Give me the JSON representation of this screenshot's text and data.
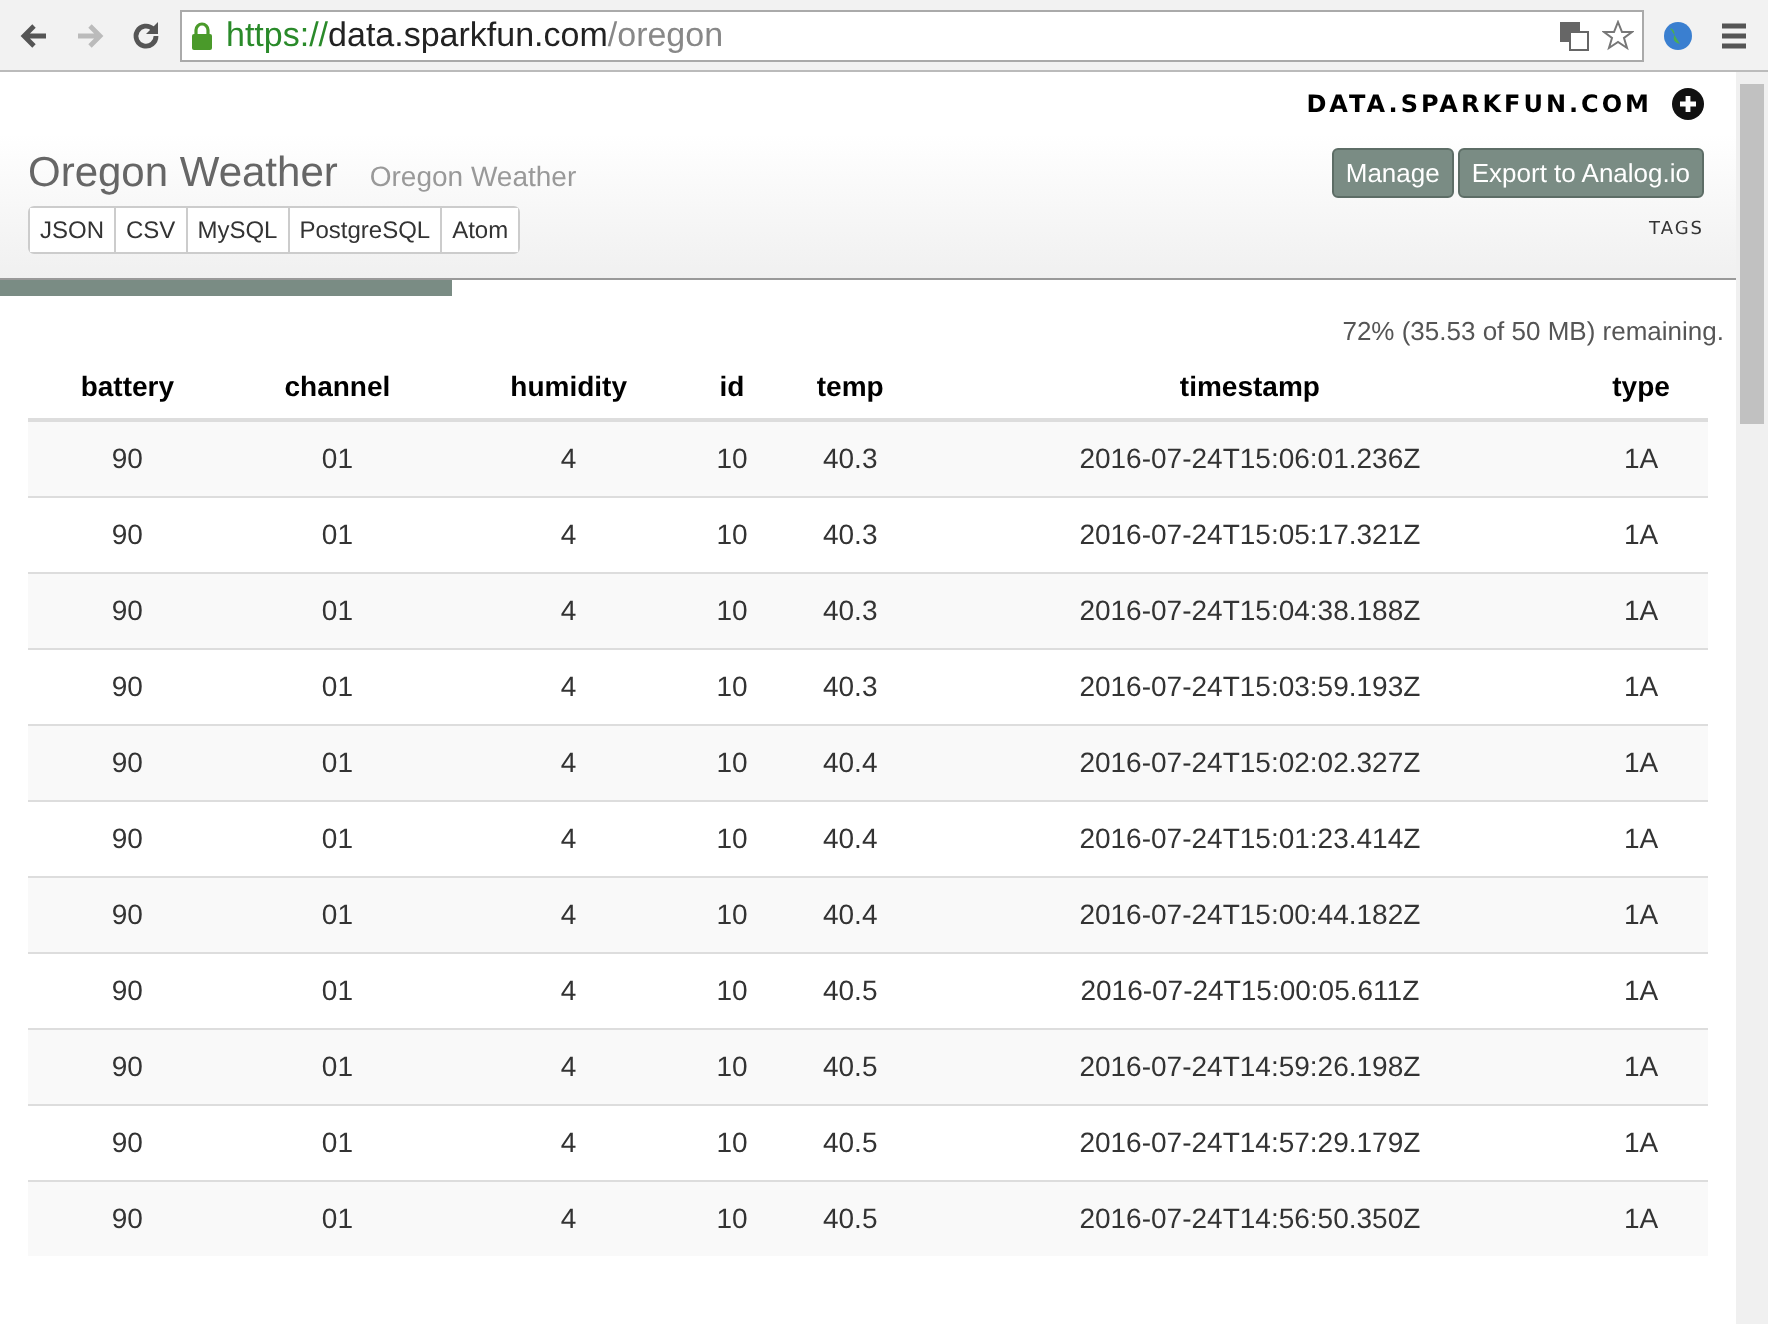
{
  "browser": {
    "url_scheme": "https://",
    "url_host": "data.sparkfun.com",
    "url_path": "/oregon"
  },
  "header": {
    "site": "DATA.SPARKFUN.COM",
    "title": "Oregon Weather",
    "subtitle": "Oregon Weather",
    "formats": [
      "JSON",
      "CSV",
      "MySQL",
      "PostgreSQL",
      "Atom"
    ],
    "actions": [
      "Manage",
      "Export to Analog.io"
    ],
    "tags_label": "TAGS"
  },
  "storage": {
    "level": 0.26,
    "reading": "72% (35.53 of 50 MB) remaining."
  },
  "table": {
    "columns": [
      "battery",
      "channel",
      "humidity",
      "id",
      "temp",
      "timestamp",
      "type"
    ],
    "rows": [
      [
        "90",
        "01",
        "4",
        "10",
        "40.3",
        "2016-07-24T15:06:01.236Z",
        "1A"
      ],
      [
        "90",
        "01",
        "4",
        "10",
        "40.3",
        "2016-07-24T15:05:17.321Z",
        "1A"
      ],
      [
        "90",
        "01",
        "4",
        "10",
        "40.3",
        "2016-07-24T15:04:38.188Z",
        "1A"
      ],
      [
        "90",
        "01",
        "4",
        "10",
        "40.3",
        "2016-07-24T15:03:59.193Z",
        "1A"
      ],
      [
        "90",
        "01",
        "4",
        "10",
        "40.4",
        "2016-07-24T15:02:02.327Z",
        "1A"
      ],
      [
        "90",
        "01",
        "4",
        "10",
        "40.4",
        "2016-07-24T15:01:23.414Z",
        "1A"
      ],
      [
        "90",
        "01",
        "4",
        "10",
        "40.4",
        "2016-07-24T15:00:44.182Z",
        "1A"
      ],
      [
        "90",
        "01",
        "4",
        "10",
        "40.5",
        "2016-07-24T15:00:05.611Z",
        "1A"
      ],
      [
        "90",
        "01",
        "4",
        "10",
        "40.5",
        "2016-07-24T14:59:26.198Z",
        "1A"
      ],
      [
        "90",
        "01",
        "4",
        "10",
        "40.5",
        "2016-07-24T14:57:29.179Z",
        "1A"
      ],
      [
        "90",
        "01",
        "4",
        "10",
        "40.5",
        "2016-07-24T14:56:50.350Z",
        "1A"
      ]
    ]
  }
}
